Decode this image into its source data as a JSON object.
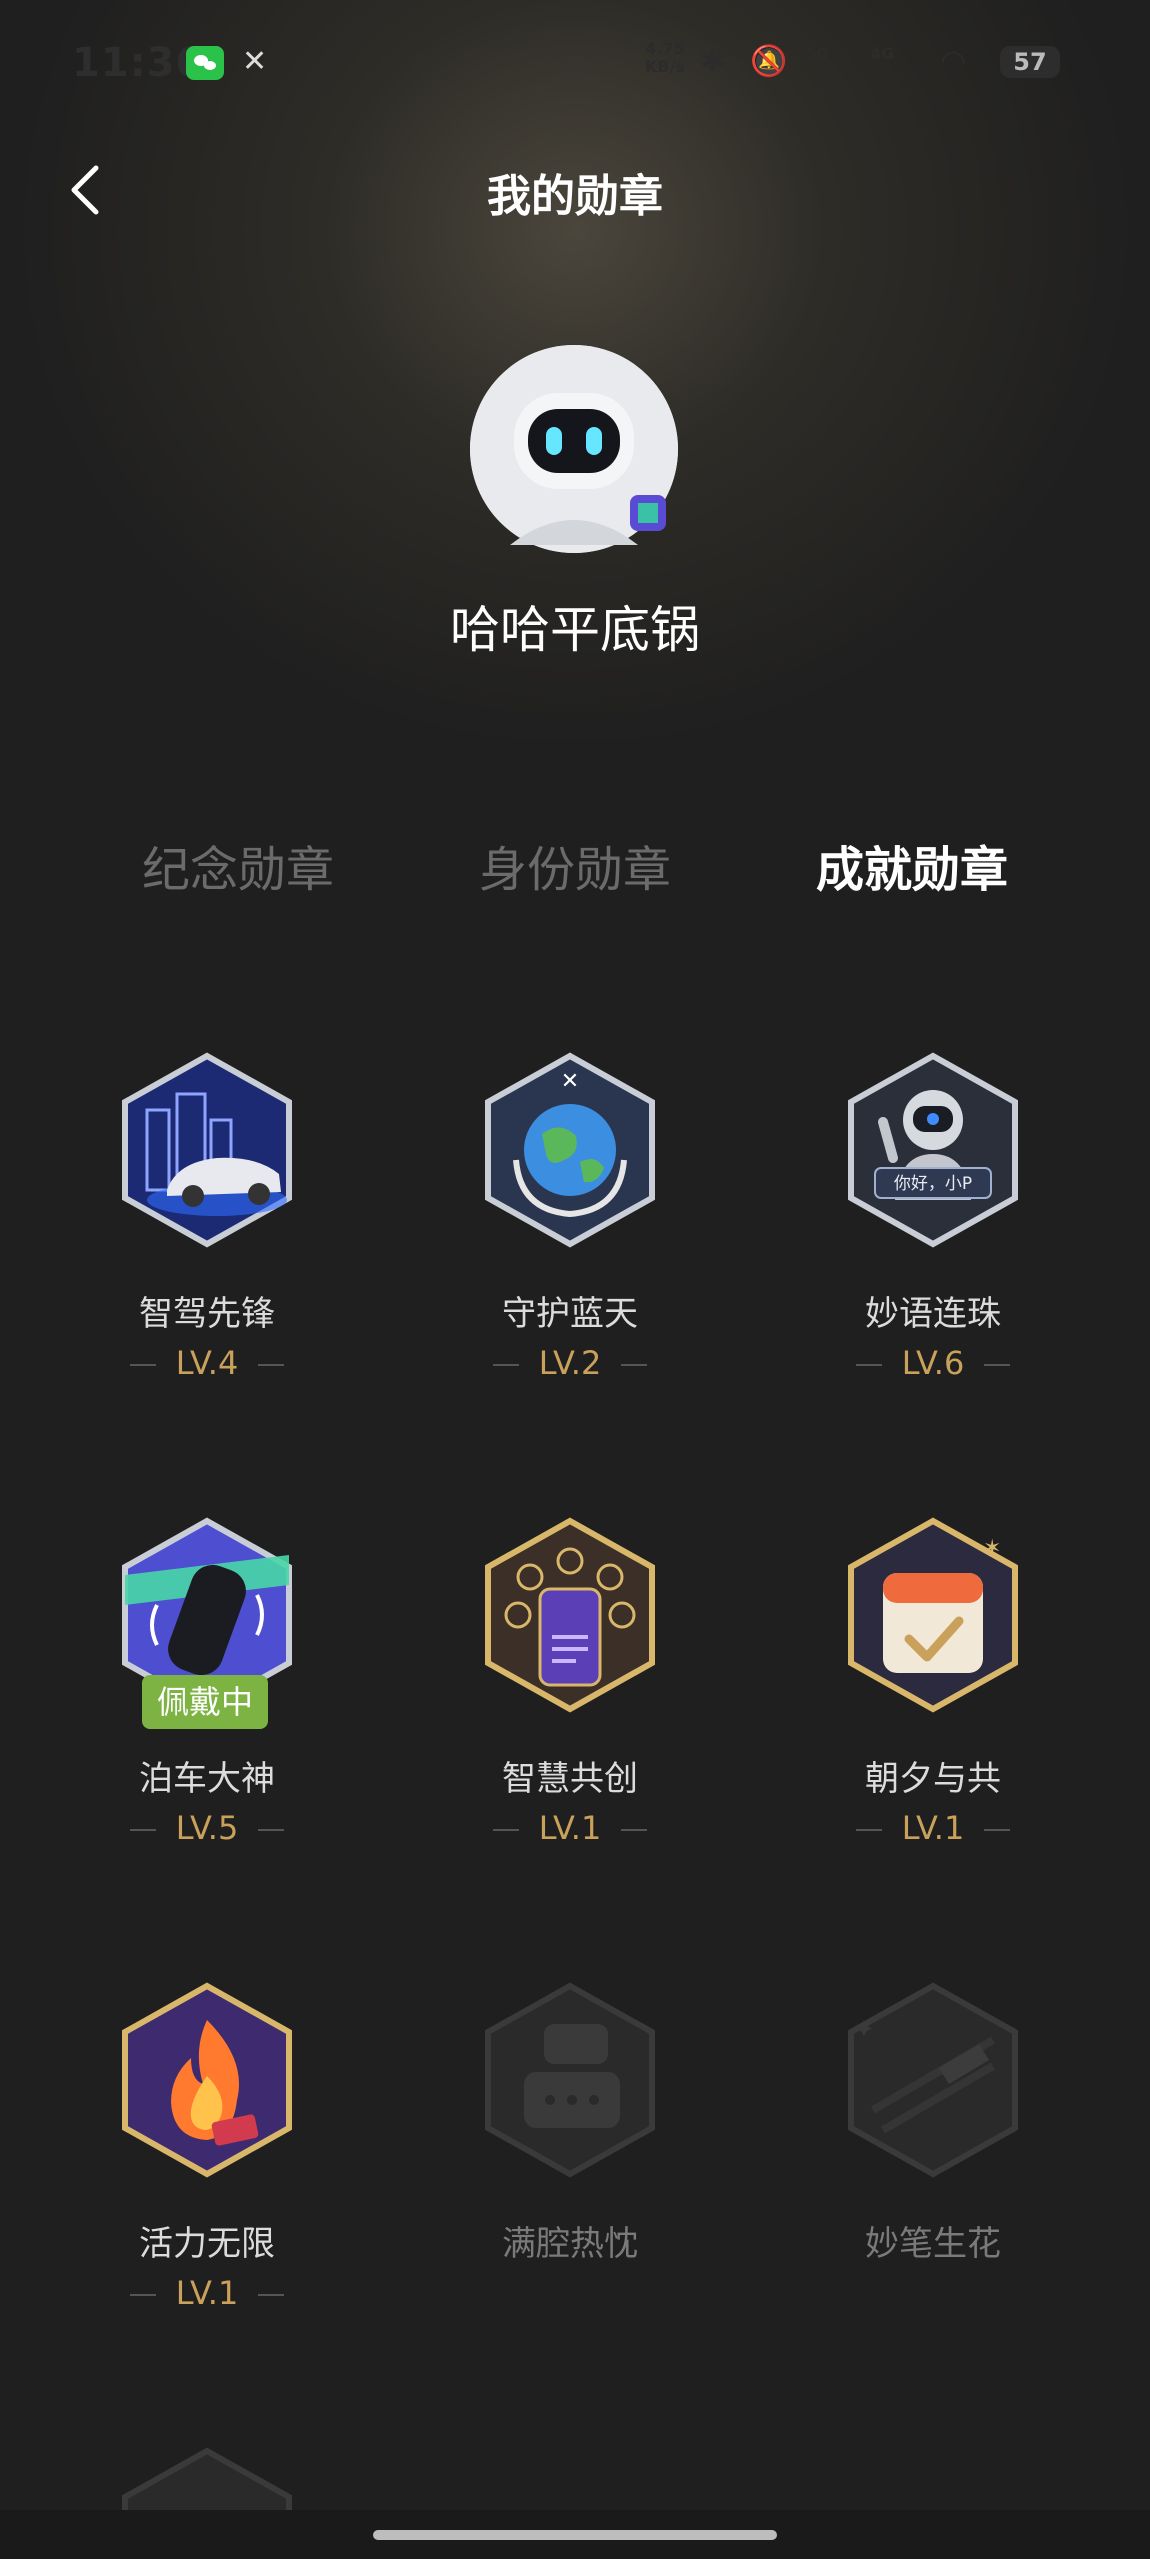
{
  "status_bar": {
    "time": "11:36",
    "net_speed_value": "4.75",
    "net_speed_unit": "KB/s",
    "signal1": "5G",
    "signal2": "4G",
    "battery": "57"
  },
  "header": {
    "title": "我的勋章"
  },
  "profile": {
    "username": "哈哈平底锅"
  },
  "tabs": [
    {
      "label": "纪念勋章",
      "active": false
    },
    {
      "label": "身份勋章",
      "active": false
    },
    {
      "label": "成就勋章",
      "active": true
    }
  ],
  "badges": [
    {
      "name": "智驾先锋",
      "level": "LV.4",
      "icon": "car-city-icon"
    },
    {
      "name": "守护蓝天",
      "level": "LV.2",
      "icon": "earth-hands-icon"
    },
    {
      "name": "妙语连珠",
      "level": "LV.6",
      "icon": "robot-greeting-icon",
      "greeting": "你好，小P"
    },
    {
      "name": "泊车大神",
      "level": "LV.5",
      "icon": "parking-car-icon",
      "tag": "佩戴中"
    },
    {
      "name": "智慧共创",
      "level": "LV.1",
      "icon": "co-create-phone-icon"
    },
    {
      "name": "朝夕与共",
      "level": "LV.1",
      "icon": "calendar-check-icon"
    },
    {
      "name": "活力无限",
      "level": "LV.1",
      "icon": "fire-icon"
    },
    {
      "name": "满腔热忱",
      "level": "",
      "icon": "chat-bubbles-icon"
    },
    {
      "name": "妙笔生花",
      "level": "",
      "icon": "pen-icon"
    }
  ],
  "colors": {
    "background": "#1f1f1f",
    "level_gold": "#c9a15a",
    "wearing_green": "#7cb342"
  }
}
